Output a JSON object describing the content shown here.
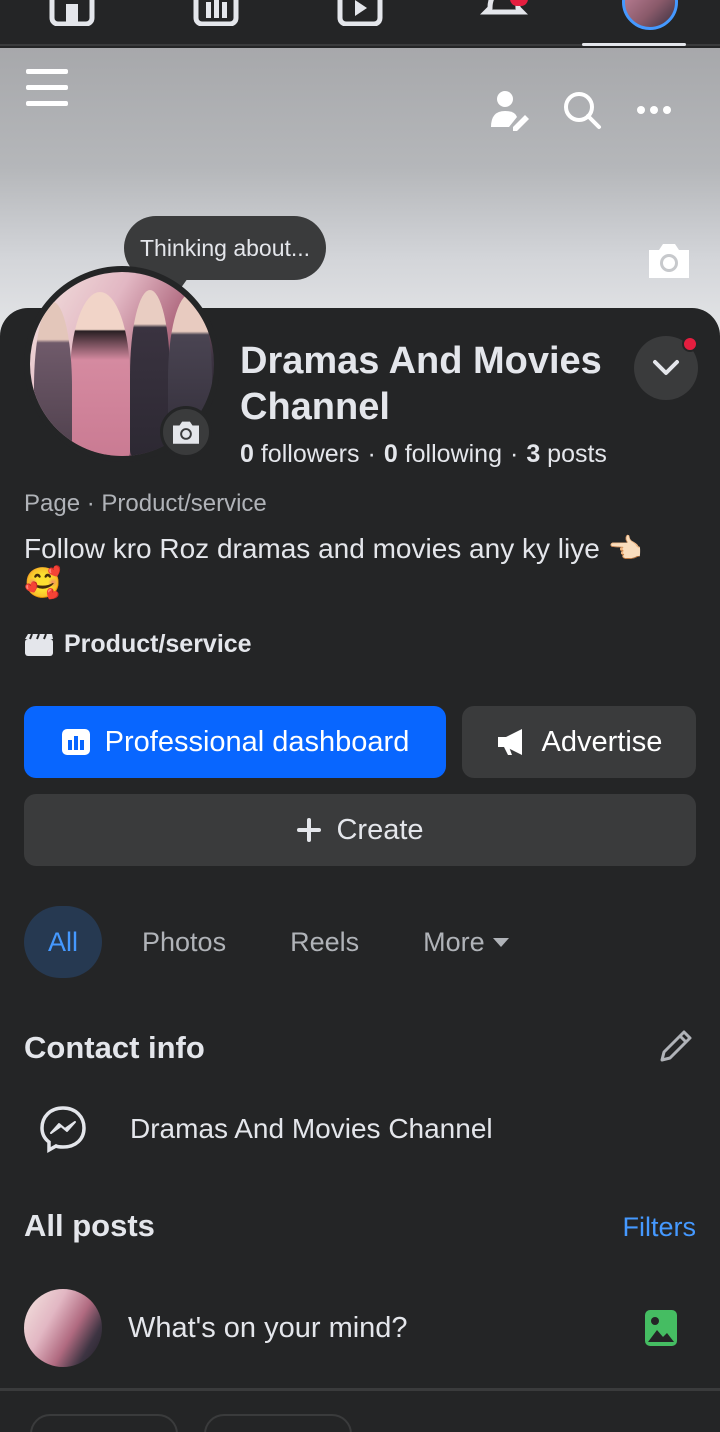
{
  "thought_bubble": "Thinking about...",
  "page": {
    "name": "Dramas And Movies Channel",
    "followers_count": "0",
    "followers_label": "followers",
    "following_count": "0",
    "following_label": "following",
    "posts_count": "3",
    "posts_label": "posts",
    "category_line": "Page · Product/service",
    "bio": "Follow kro Roz dramas and movies any ky liye 👈🏻",
    "bio_emoji": "🥰",
    "info_item": "Product/service"
  },
  "buttons": {
    "dashboard": "Professional dashboard",
    "advertise": "Advertise",
    "create": "Create"
  },
  "tabs": [
    {
      "label": "All",
      "active": true
    },
    {
      "label": "Photos"
    },
    {
      "label": "Reels"
    },
    {
      "label": "More"
    }
  ],
  "contact": {
    "title": "Contact info",
    "messenger_name": "Dramas And Movies Channel"
  },
  "posts": {
    "title": "All posts",
    "filters": "Filters",
    "composer_prompt": "What's on your mind?"
  },
  "colors": {
    "background": "#242526",
    "accent": "#0866ff",
    "link": "#4599ff",
    "photo_icon": "#45bd62",
    "notification": "#e41e3f"
  }
}
